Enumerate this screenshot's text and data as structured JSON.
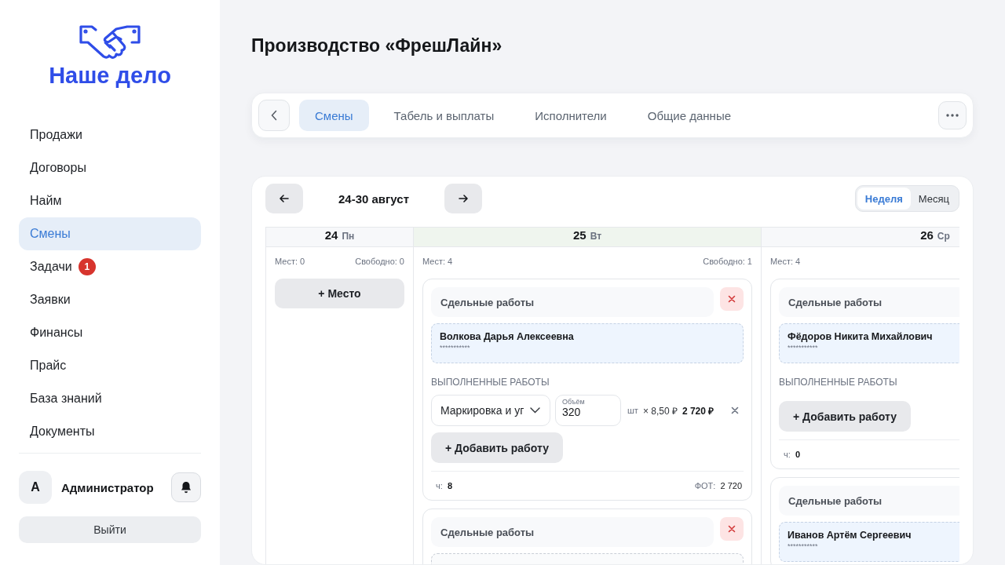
{
  "sidebar": {
    "logo": "Наше дело",
    "items": [
      {
        "label": "Продажи",
        "selected": false
      },
      {
        "label": "Договоры",
        "selected": false
      },
      {
        "label": "Найм",
        "selected": false
      },
      {
        "label": "Смены",
        "selected": true
      },
      {
        "label": "Задачи",
        "selected": false,
        "badge": "1"
      },
      {
        "label": "Заявки",
        "selected": false
      },
      {
        "label": "Финансы",
        "selected": false
      },
      {
        "label": "Прайс",
        "selected": false
      },
      {
        "label": "База знаний",
        "selected": false
      },
      {
        "label": "Документы",
        "selected": false
      }
    ],
    "user": {
      "initial": "А",
      "name": "Администратор"
    },
    "logout": "Выйти"
  },
  "page_title": "Производство «ФрешЛайн»",
  "tabs": [
    {
      "label": "Смены",
      "selected": true
    },
    {
      "label": "Табель и выплаты",
      "selected": false
    },
    {
      "label": "Исполнители",
      "selected": false
    },
    {
      "label": "Общие данные",
      "selected": false
    }
  ],
  "calendar": {
    "range": "24-30 август",
    "views": [
      {
        "label": "Неделя",
        "selected": true
      },
      {
        "label": "Месяц",
        "selected": false
      }
    ],
    "days": [
      {
        "day": "24",
        "weekday": "Пн",
        "today": false,
        "places": "Мест: 0",
        "free": "Свободно: 0",
        "add_place": "+ Место"
      },
      {
        "day": "25",
        "weekday": "Вт",
        "today": true,
        "places": "Мест: 4",
        "free": "Свободно: 1",
        "cards": [
          {
            "title": "Сдельные работы",
            "removable": true,
            "assignee": {
              "name": "Волкова Дарья Алексеевна",
              "masked": "***********"
            },
            "works_label": "ВЫПОЛНЕННЫЕ РАБОТЫ",
            "works": [
              {
                "job": "Маркировка и уг",
                "volume_label": "Объём",
                "volume": "320",
                "unit": "шт",
                "rate": "× 8,50 ₽",
                "sum": "2 720 ₽"
              }
            ],
            "add_work": "+ Добавить работу",
            "hours_label": "ч:",
            "hours": "8",
            "payroll_label": "ФОТ:",
            "payroll": "2 720"
          },
          {
            "title": "Сдельные работы",
            "removable": true
          }
        ]
      },
      {
        "day": "26",
        "weekday": "Ср",
        "today": false,
        "places": "Мест: 4",
        "cards": [
          {
            "title": "Сдельные работы",
            "assignee": {
              "name": "Фёдоров Никита Михайлович",
              "masked": "***********"
            },
            "works_label": "ВЫПОЛНЕННЫЕ РАБОТЫ",
            "add_work": "+ Добавить работу",
            "hours_label": "ч:",
            "hours": "0"
          },
          {
            "title": "Сдельные работы",
            "assignee": {
              "name": "Иванов Артём Сергеевич",
              "masked": "***********"
            }
          }
        ]
      }
    ]
  }
}
